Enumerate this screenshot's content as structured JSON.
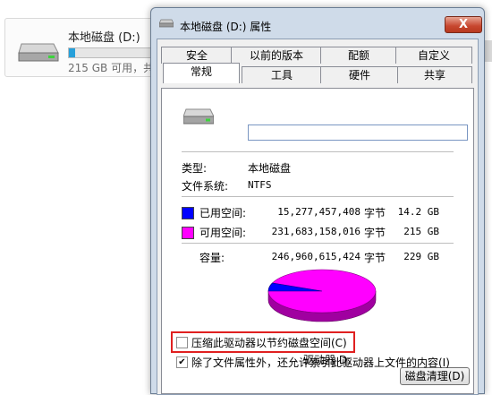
{
  "explorer": {
    "drive_name": "本地磁盘 (D:)",
    "drive_free": "215 GB 可用，共",
    "used_fraction": 0.06
  },
  "dialog": {
    "title": "本地磁盘 (D:) 属性",
    "close_label": "X",
    "tabs_back": [
      "安全",
      "以前的版本",
      "配额",
      "自定义"
    ],
    "tabs_front": [
      "常规",
      "工具",
      "硬件",
      "共享"
    ],
    "active_tab": "常规",
    "name_value": "",
    "type_label": "类型:",
    "type_value": "本地磁盘",
    "fs_label": "文件系统:",
    "fs_value": "NTFS",
    "used": {
      "label": "已用空间:",
      "bytes": "15,277,457,408",
      "unit": "字节",
      "size": "14.2 GB",
      "color": "#0000ff"
    },
    "free": {
      "label": "可用空间:",
      "bytes": "231,683,158,016",
      "unit": "字节",
      "size": "215 GB",
      "color": "#ff00ff"
    },
    "capacity": {
      "label": "容量:",
      "bytes": "246,960,615,424",
      "unit": "字节",
      "size": "229 GB"
    },
    "pie_used_fraction": 0.0619,
    "drive_label": "驱动器 D:",
    "cleanup_button": "磁盘清理(D)",
    "compress_checkbox": {
      "label": "压缩此驱动器以节约磁盘空间(C)",
      "checked": false
    },
    "index_checkbox": {
      "label": "除了文件属性外，还允许索引此驱动器上文件的内容(I)",
      "checked": true
    }
  }
}
